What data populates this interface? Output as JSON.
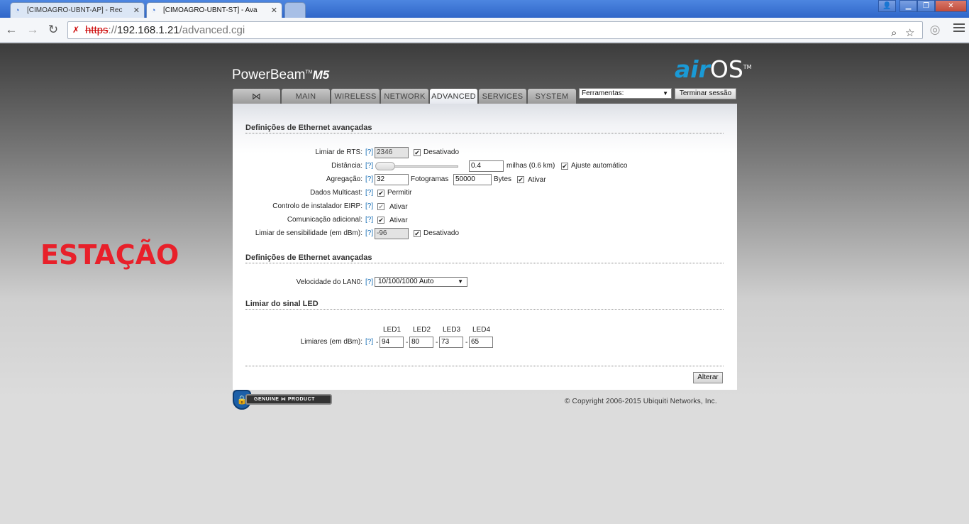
{
  "browser": {
    "tabs": [
      {
        "title": "[CIMOAGRO-UBNT-AP] - Rec",
        "active": false
      },
      {
        "title": "[CIMOAGRO-UBNT-ST] - Ava",
        "active": true
      }
    ],
    "url_scheme": "https",
    "url_rest_sep": "://",
    "url_host": "192.168.1.21",
    "url_path": "/advanced.cgi"
  },
  "side_label": "ESTAÇÃO",
  "header": {
    "brand": "PowerBeam",
    "brand_tm": "TM",
    "brand_model": "M5",
    "logo_air": "air",
    "logo_os": "OS",
    "logo_tm": "TM"
  },
  "nav": {
    "tabs": [
      "MAIN",
      "WIRELESS",
      "NETWORK",
      "ADVANCED",
      "SERVICES",
      "SYSTEM"
    ],
    "active": "ADVANCED",
    "tools_label": "Ferramentas:",
    "logout_label": "Terminar sessão"
  },
  "section1": {
    "title": "Definições de Ethernet avançadas",
    "help": "[?]",
    "rts": {
      "label": "Limiar de RTS:",
      "value": "2346",
      "check_label": "Desativado"
    },
    "distance": {
      "label": "Distância:",
      "value": "0.4",
      "unit": "milhas (0.6 km)",
      "check_label": "Ajuste automático",
      "slider_fraction": 0.0
    },
    "aggregation": {
      "label": "Agregação:",
      "frames_value": "32",
      "frames_label": "Fotogramas",
      "bytes_value": "50000",
      "bytes_label": "Bytes",
      "check_label": "Ativar"
    },
    "multicast": {
      "label": "Dados Multicast:",
      "check_label": "Permitir"
    },
    "eirp": {
      "label": "Controlo de instalador EIRP:",
      "check_label": "Ativar"
    },
    "extra_comm": {
      "label": "Comunicação adicional:",
      "check_label": "Ativar"
    },
    "sensitivity": {
      "label": "Limiar de sensibilidade (em dBm):",
      "value": "-96",
      "check_label": "Desativado"
    }
  },
  "section2": {
    "title": "Definições de Ethernet avançadas",
    "lan_label": "Velocidade do LAN0:",
    "lan_value": "10/100/1000 Auto"
  },
  "section3": {
    "title": "Limiar do sinal LED",
    "thresholds_label": "Limiares (em dBm):",
    "led_names": [
      "LED1",
      "LED2",
      "LED3",
      "LED4"
    ],
    "led_values": [
      "94",
      "80",
      "73",
      "65"
    ],
    "dash": "-"
  },
  "apply_label": "Alterar",
  "footer": {
    "genuine": "GENUINE",
    "product": "PRODUCT",
    "copyright": "© Copyright 2006-2015 Ubiquiti Networks, Inc."
  },
  "icons": {
    "back": "back-arrow-icon",
    "forward": "forward-arrow-icon",
    "reload": "reload-icon",
    "zoom": "magnifier-icon",
    "bookmark": "star-icon",
    "menu": "hamburger-menu-icon"
  }
}
